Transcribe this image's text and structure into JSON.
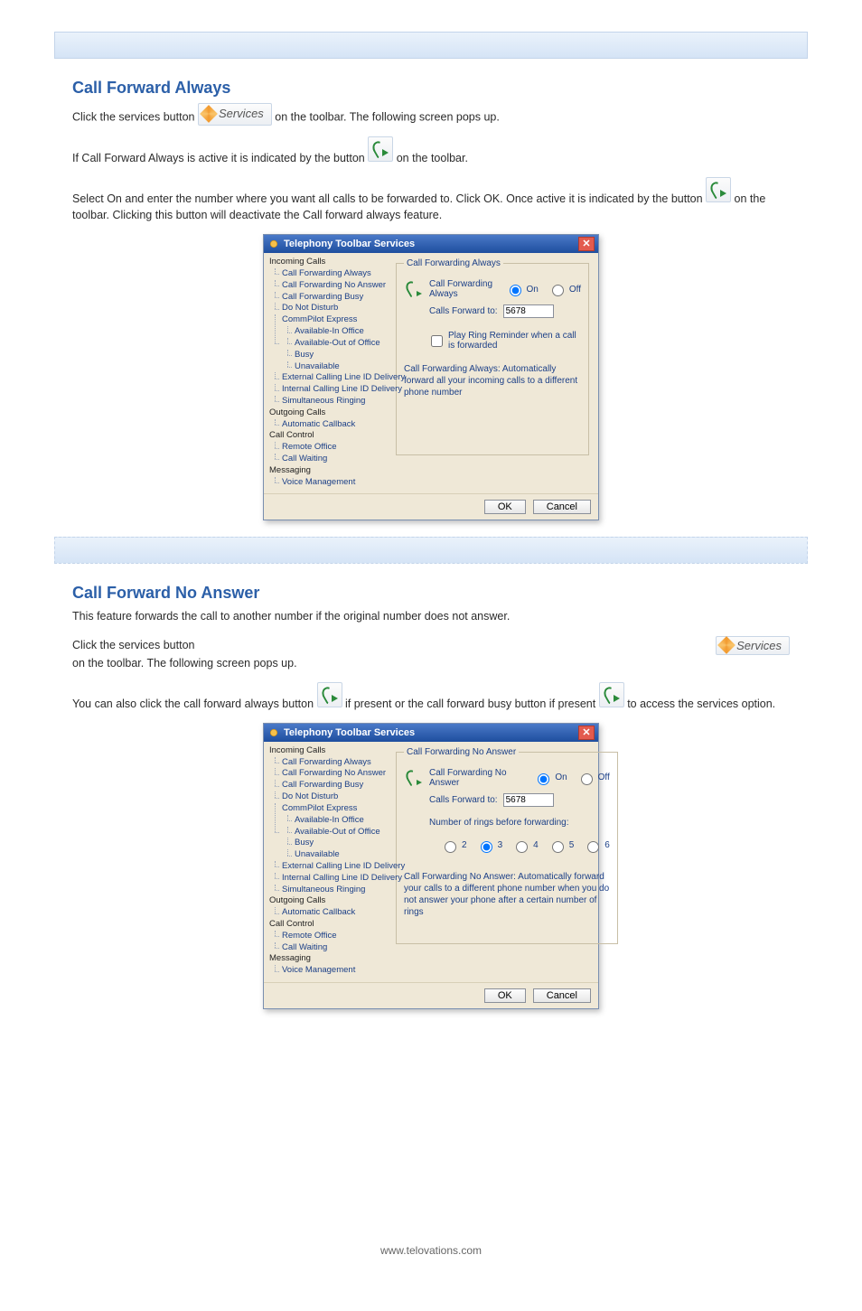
{
  "section1": {
    "title": "Call Forward Always",
    "p1_before": "Click the services button ",
    "p1_after": " on the toolbar. The following screen pops up.",
    "p2_before": "If Call Forward Always is active it is indicated by the button ",
    "p2_after": " on the toolbar.",
    "p3_before": "Select On and enter the number where you want all calls to be forwarded to. Click OK. Once active it is indicated by the button ",
    "p3_after": " on the toolbar. Clicking this button will deactivate the Call forward always feature."
  },
  "section2": {
    "title": "Call Forward No Answer",
    "p1": "This feature forwards the call to another number if the original number does not answer.",
    "p2_before": "Click the services button ",
    "p2_after": " on the toolbar. The following screen pops up.",
    "p3_before": "You can also click the call forward always button ",
    "p3_middle": " if present or the call forward busy button if present ",
    "p3_after": " to access the services option."
  },
  "dialog": {
    "title": "Telephony Toolbar Services",
    "tree": {
      "incoming": "Incoming Calls",
      "items_incoming": [
        "Call Forwarding Always",
        "Call Forwarding No Answer",
        "Call Forwarding Busy",
        "Do Not Disturb",
        "CommPilot Express"
      ],
      "commpilot_sub": [
        "Available-In Office",
        "Available-Out of Office",
        "Busy",
        "Unavailable"
      ],
      "items_incoming_tail": [
        "External Calling Line ID Delivery",
        "Internal Calling Line ID Delivery",
        "Simultaneous Ringing"
      ],
      "outgoing": "Outgoing Calls",
      "items_outgoing": [
        "Automatic Callback"
      ],
      "callcontrol": "Call Control",
      "items_callcontrol": [
        "Remote Office",
        "Call Waiting"
      ],
      "messaging": "Messaging",
      "items_messaging": [
        "Voice Management"
      ]
    },
    "panel1": {
      "legend": "Call Forwarding Always",
      "feature_label": "Call Forwarding Always",
      "on": "On",
      "off": "Off",
      "forward_to": "Calls Forward to:",
      "value": "5678",
      "ring_reminder": "Play Ring Reminder when a call is forwarded",
      "desc": "Call Forwarding Always: Automatically forward all your incoming calls to a different phone number"
    },
    "panel2": {
      "legend": "Call Forwarding No Answer",
      "feature_label": "Call Forwarding No Answer",
      "on": "On",
      "off": "Off",
      "forward_to": "Calls Forward to:",
      "value": "5678",
      "rings_label": "Number of rings before forwarding:",
      "rings": [
        "2",
        "3",
        "4",
        "5",
        "6"
      ],
      "rings_selected": "3",
      "desc": "Call Forwarding No Answer: Automatically forward your calls to a different phone number when you do not answer your phone after a certain number of rings"
    },
    "ok": "OK",
    "cancel": "Cancel"
  },
  "services_label": "Services",
  "footer": "www.telovations.com"
}
